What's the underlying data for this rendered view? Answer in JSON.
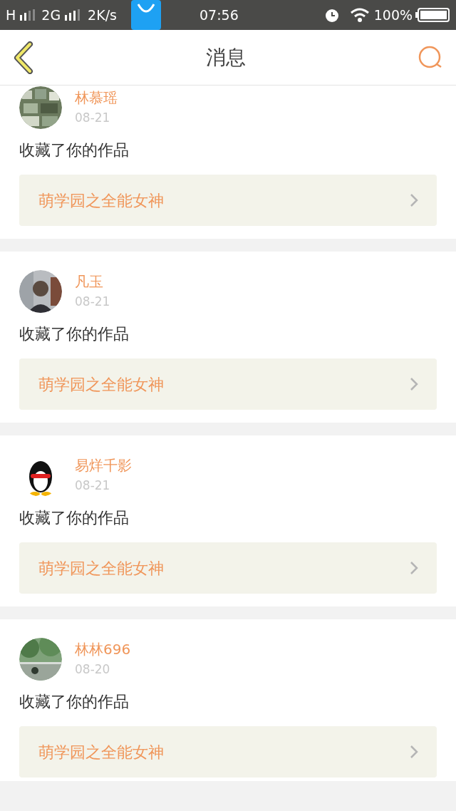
{
  "status_bar": {
    "network_1": "H",
    "network_2": "2G",
    "speed": "2K/s",
    "time": "07:56",
    "battery": "100%"
  },
  "header": {
    "title": "消息"
  },
  "messages": [
    {
      "name": "林慕瑶",
      "date": "08-21",
      "action": "收藏了你的作品",
      "work": "萌学园之全能女神"
    },
    {
      "name": "凡玉",
      "date": "08-21",
      "action": "收藏了你的作品",
      "work": "萌学园之全能女神"
    },
    {
      "name": "易烊千影",
      "date": "08-21",
      "action": "收藏了你的作品",
      "work": "萌学园之全能女神"
    },
    {
      "name": "林林696",
      "date": "08-20",
      "action": "收藏了你的作品",
      "work": "萌学园之全能女神"
    }
  ]
}
